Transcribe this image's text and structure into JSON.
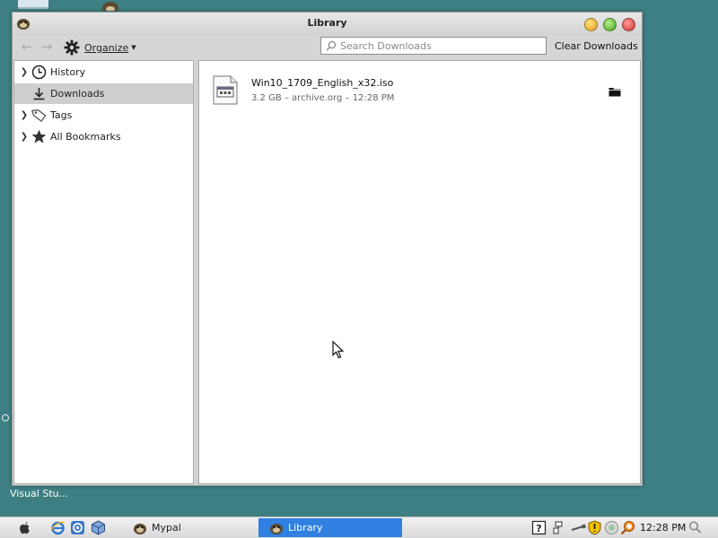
{
  "window": {
    "title": "Library",
    "toolbar": {
      "organize_label": "Organize",
      "search_placeholder": "Search Downloads",
      "clear_downloads_label": "Clear Downloads"
    }
  },
  "sidebar": {
    "items": [
      {
        "label": "History",
        "icon": "clock-icon",
        "expandable": true,
        "selected": false
      },
      {
        "label": "Downloads",
        "icon": "download-icon",
        "expandable": false,
        "selected": true
      },
      {
        "label": "Tags",
        "icon": "tag-icon",
        "expandable": true,
        "selected": false
      },
      {
        "label": "All Bookmarks",
        "icon": "star-icon",
        "expandable": true,
        "selected": false
      }
    ]
  },
  "downloads": [
    {
      "name": "Win10_1709_English_x32.iso",
      "status": "3.2 GB – archive.org – 12:28 PM"
    }
  ],
  "desktop": {
    "label": "Visual Stu..."
  },
  "taskbar": {
    "tasks": [
      {
        "label": "Mypal",
        "active": false
      },
      {
        "label": "Library",
        "active": true
      }
    ],
    "clock": "12:28 PM"
  },
  "colors": {
    "desktop": "#3d7f82",
    "active_task": "#2f80e0",
    "sidebar_selected": "#cfcfcf"
  }
}
